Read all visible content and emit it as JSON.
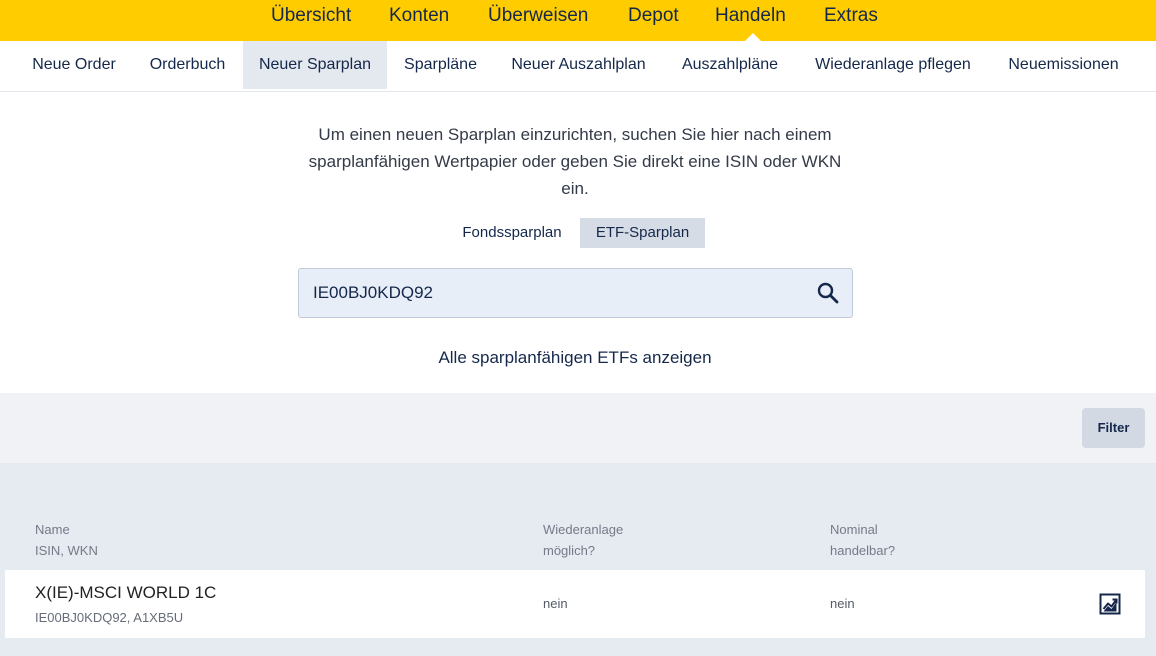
{
  "top_nav": {
    "items": [
      "Übersicht",
      "Konten",
      "Überweisen",
      "Depot",
      "Handeln",
      "Extras"
    ],
    "active": "Handeln"
  },
  "sub_nav": {
    "items": [
      "Neue Order",
      "Orderbuch",
      "Neuer Sparplan",
      "Sparpläne",
      "Neuer Auszahlplan",
      "Auszahlpläne",
      "Wiederanlage pflegen",
      "Neuemissionen"
    ],
    "active": "Neuer Sparplan"
  },
  "intro_text": "Um einen neuen Sparplan einzurichten, suchen Sie hier nach einem sparplanfähigen Wertpapier oder geben Sie direkt eine ISIN oder WKN ein.",
  "plan_toggle": {
    "options": [
      "Fondssparplan",
      "ETF-Sparplan"
    ],
    "selected": "ETF-Sparplan"
  },
  "search": {
    "value": "IE00BJ0KDQ92",
    "icon": "search-icon"
  },
  "all_etfs_link": "Alle sparplanfähigen ETFs anzeigen",
  "filter_button": "Filter",
  "table": {
    "headers": {
      "name": [
        "Name",
        "ISIN, WKN"
      ],
      "reinvest": [
        "Wiederanlage",
        "möglich?"
      ],
      "nominal": [
        "Nominal",
        "handelbar?"
      ]
    },
    "rows": [
      {
        "name": "X(IE)-MSCI WORLD 1C",
        "isin_wkn": "IE00BJ0KDQ92, A1XB5U",
        "reinvest": "nein",
        "nominal": "nein",
        "action_icon": "chart-icon"
      }
    ]
  },
  "colors": {
    "brand_yellow": "#ffcc00",
    "brand_navy": "#15284b"
  }
}
